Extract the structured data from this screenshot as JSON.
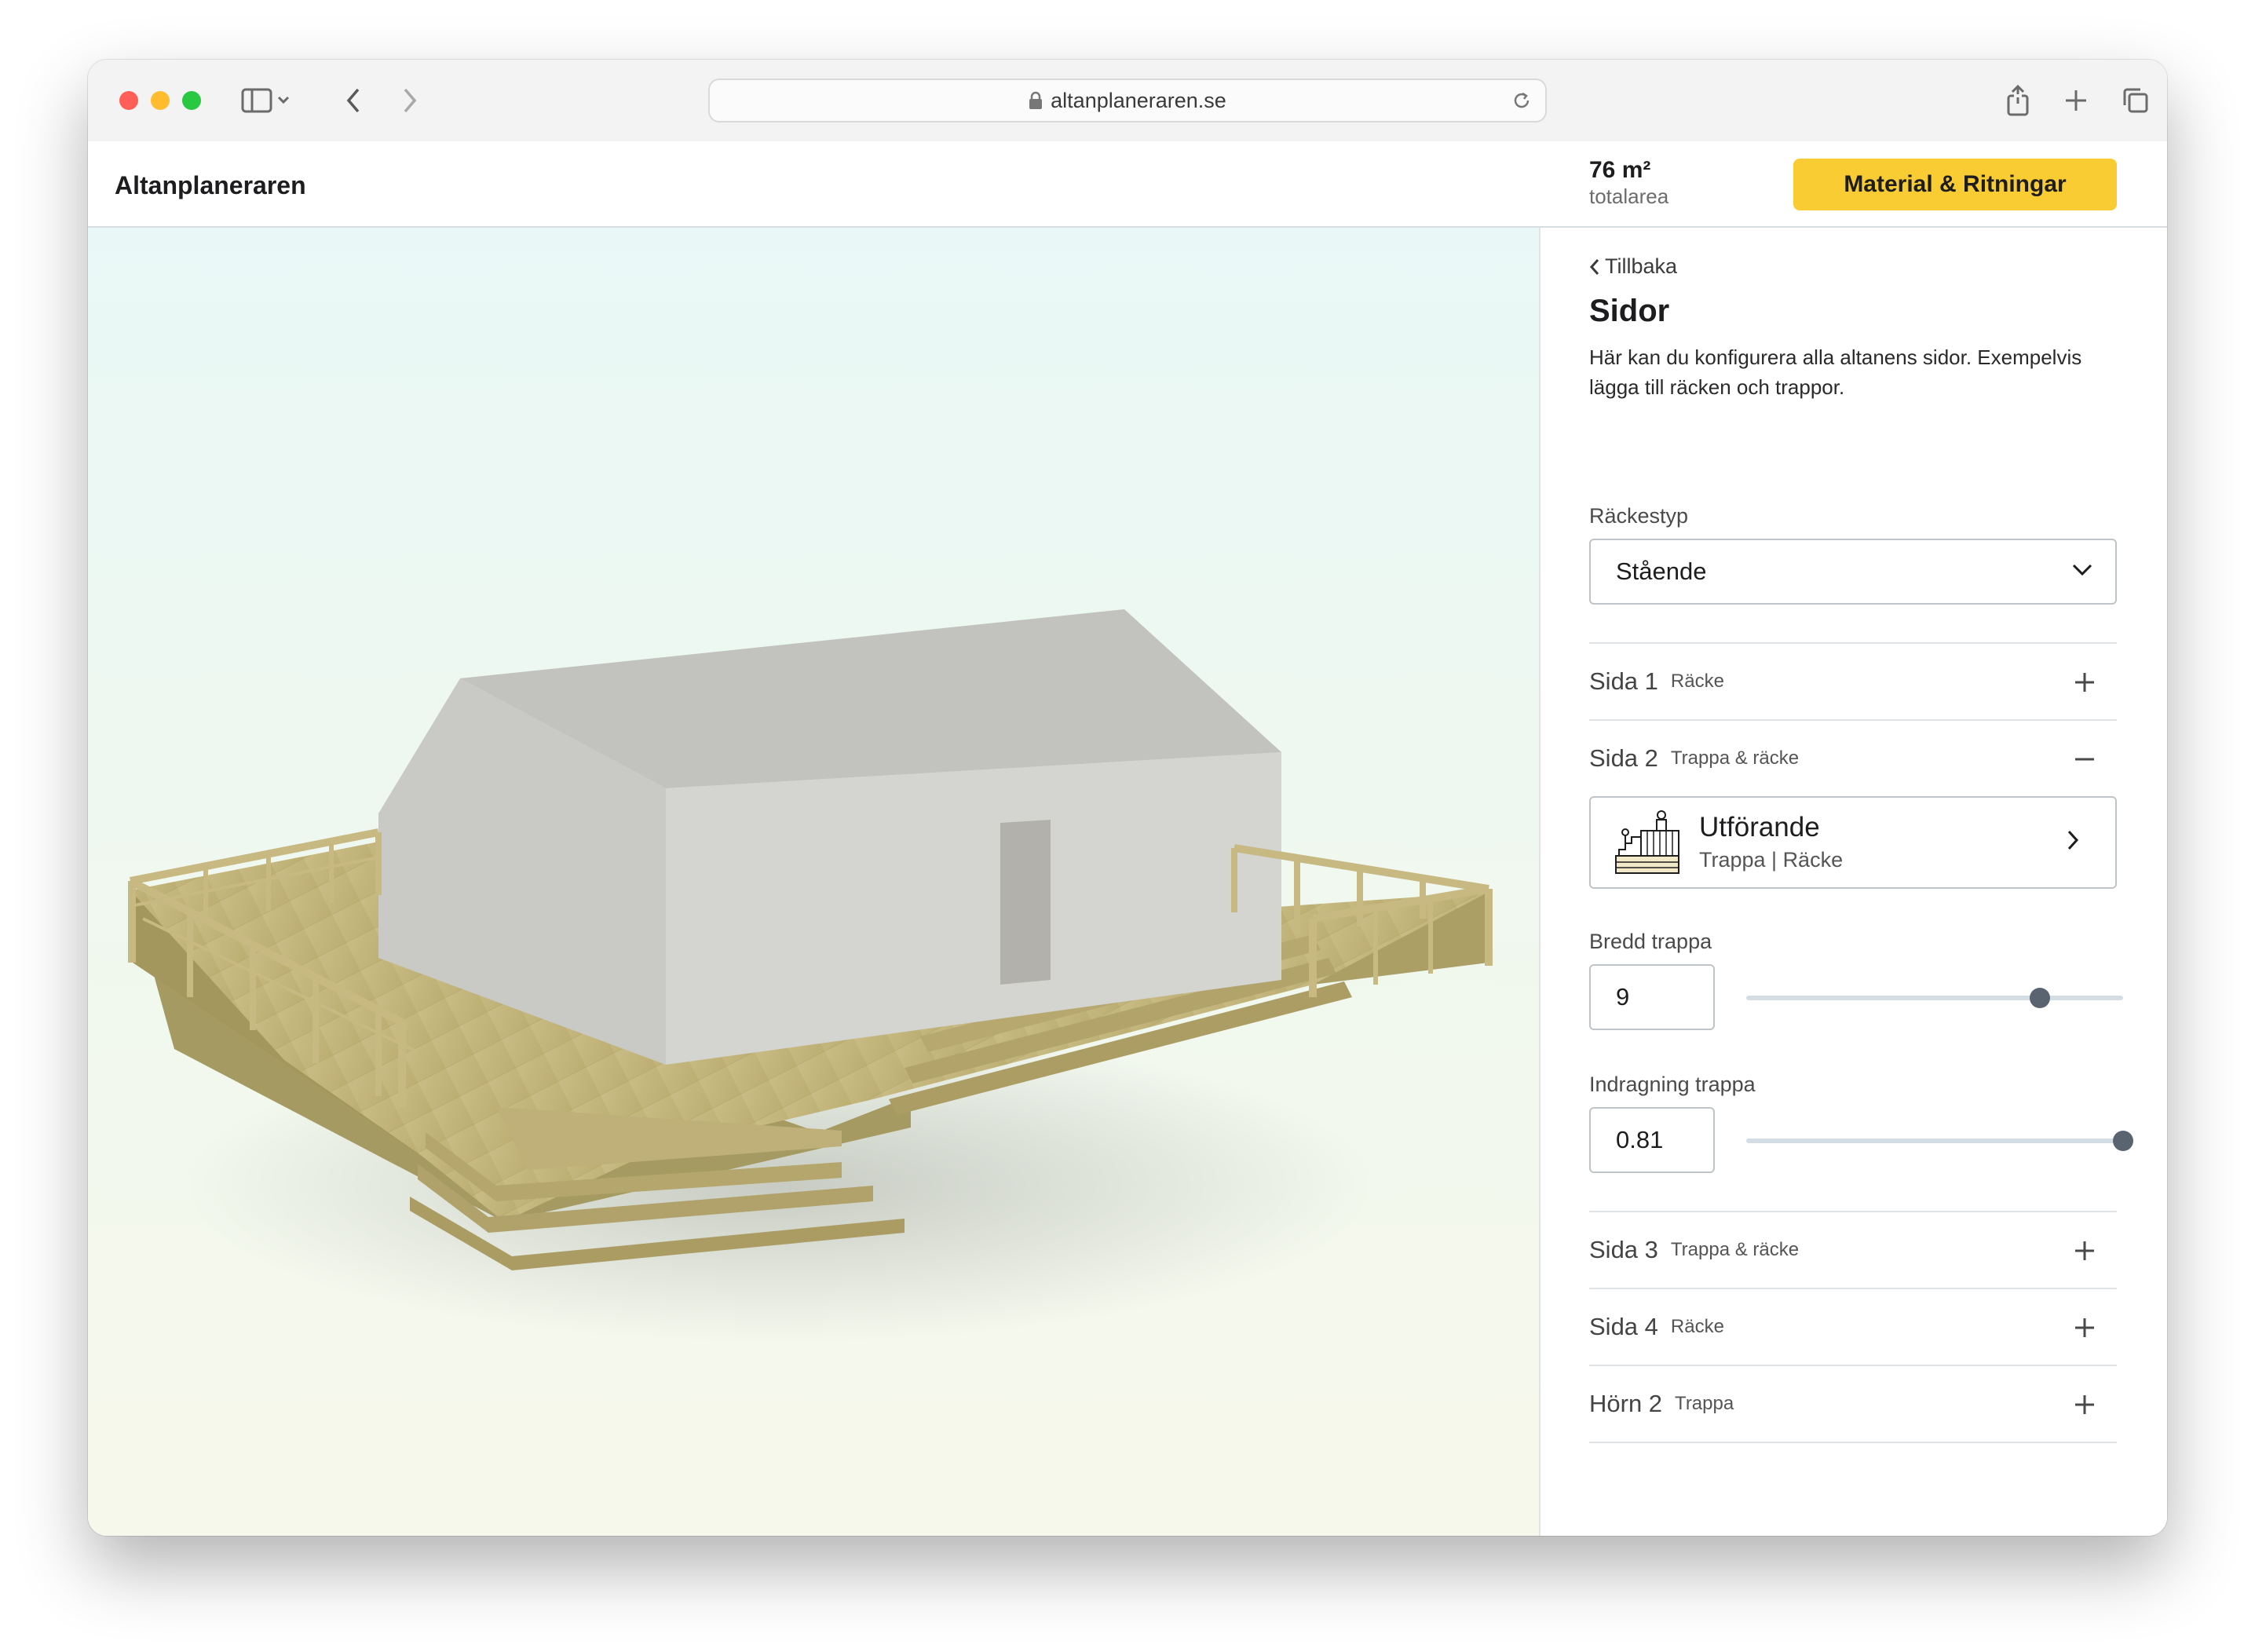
{
  "browser": {
    "url": "altanplaneraren.se"
  },
  "header": {
    "app_title": "Altanplaneraren",
    "area_value": "76 m²",
    "area_label": "totalarea",
    "cta_label": "Material & Ritningar"
  },
  "panel": {
    "back_label": "Tillbaka",
    "title": "Sidor",
    "description": "Här kan du konfigurera alla altanens sidor. Exempelvis lägga till räcken och trappor.",
    "railing_type_label": "Räckestyp",
    "railing_type_value": "Stående",
    "sides": [
      {
        "name": "Sida 1",
        "sub": "Räcke",
        "expanded": false
      },
      {
        "name": "Sida 2",
        "sub": "Trappa & räcke",
        "expanded": true
      },
      {
        "name": "Sida 3",
        "sub": "Trappa & räcke",
        "expanded": false
      },
      {
        "name": "Sida 4",
        "sub": "Räcke",
        "expanded": false
      },
      {
        "name": "Hörn 2",
        "sub": "Trappa",
        "expanded": false
      }
    ],
    "design_card": {
      "title": "Utförande",
      "subtitle": "Trappa | Räcke"
    },
    "stair_width": {
      "label": "Bredd trappa",
      "value": "9",
      "slider_fraction": 0.78
    },
    "stair_indent": {
      "label": "Indragning trappa",
      "value": "0.81",
      "slider_fraction": 1.0
    }
  },
  "icons": {
    "sidebar": "sidebar-icon",
    "back": "chevron-left-icon",
    "forward": "chevron-right-icon",
    "lock": "lock-icon",
    "reload": "reload-icon",
    "share": "share-icon",
    "new_tab": "plus-icon",
    "tabs": "tabs-icon",
    "expand": "plus-icon",
    "collapse": "minus-icon"
  },
  "colors": {
    "accent": "#f8cc32",
    "wood": "#c2b47c",
    "house_wall": "#d2d2cf",
    "house_roof": "#c3c3bf"
  }
}
